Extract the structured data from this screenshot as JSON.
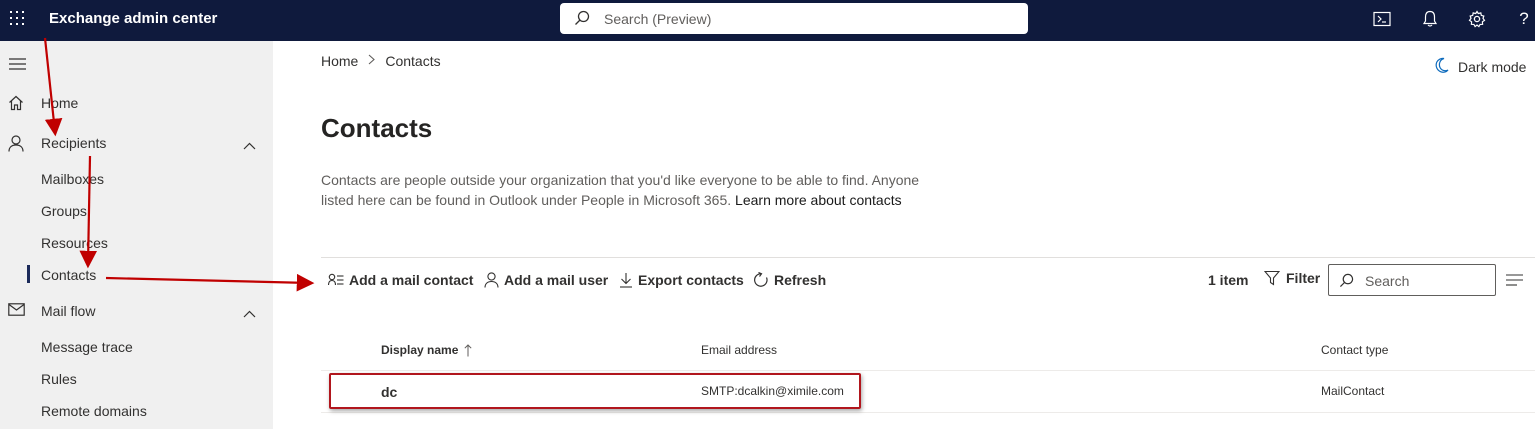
{
  "topbar": {
    "app_title": "Exchange admin center",
    "search_placeholder": "Search (Preview)",
    "icons": [
      "app-launcher-icon",
      "cloud-shell-icon",
      "notifications-icon",
      "settings-icon",
      "help-icon"
    ],
    "help_label": "?"
  },
  "sidebar": {
    "items": [
      {
        "label": "Home",
        "icon": "home-icon"
      },
      {
        "label": "Recipients",
        "icon": "person-icon",
        "expanded": true
      },
      {
        "label": "Mailboxes"
      },
      {
        "label": "Groups"
      },
      {
        "label": "Resources"
      },
      {
        "label": "Contacts",
        "active": true
      },
      {
        "label": "Mail flow",
        "icon": "mail-icon",
        "expanded": true
      },
      {
        "label": "Message trace"
      },
      {
        "label": "Rules"
      },
      {
        "label": "Remote domains"
      }
    ]
  },
  "breadcrumb": {
    "home": "Home",
    "current": "Contacts"
  },
  "dark_mode_label": "Dark mode",
  "page": {
    "title": "Contacts",
    "description": "Contacts are people outside your organization that you'd like everyone to be able to find. Anyone listed here can be found in Outlook under People in Microsoft 365. ",
    "learn_more": "Learn more about contacts"
  },
  "commands": {
    "add_mail_contact": "Add a mail contact",
    "add_mail_user": "Add a mail user",
    "export_contacts": "Export contacts",
    "refresh": "Refresh",
    "item_count": "1 item",
    "filter": "Filter",
    "search_placeholder": "Search"
  },
  "table": {
    "columns": [
      "Display name",
      "Email address",
      "Contact type"
    ],
    "sort_indicator": "ascending",
    "rows": [
      {
        "display_name": "dc",
        "email": "SMTP:dcalkin@ximile.com",
        "type": "MailContact"
      }
    ]
  },
  "annotation_color": "#b1161d"
}
